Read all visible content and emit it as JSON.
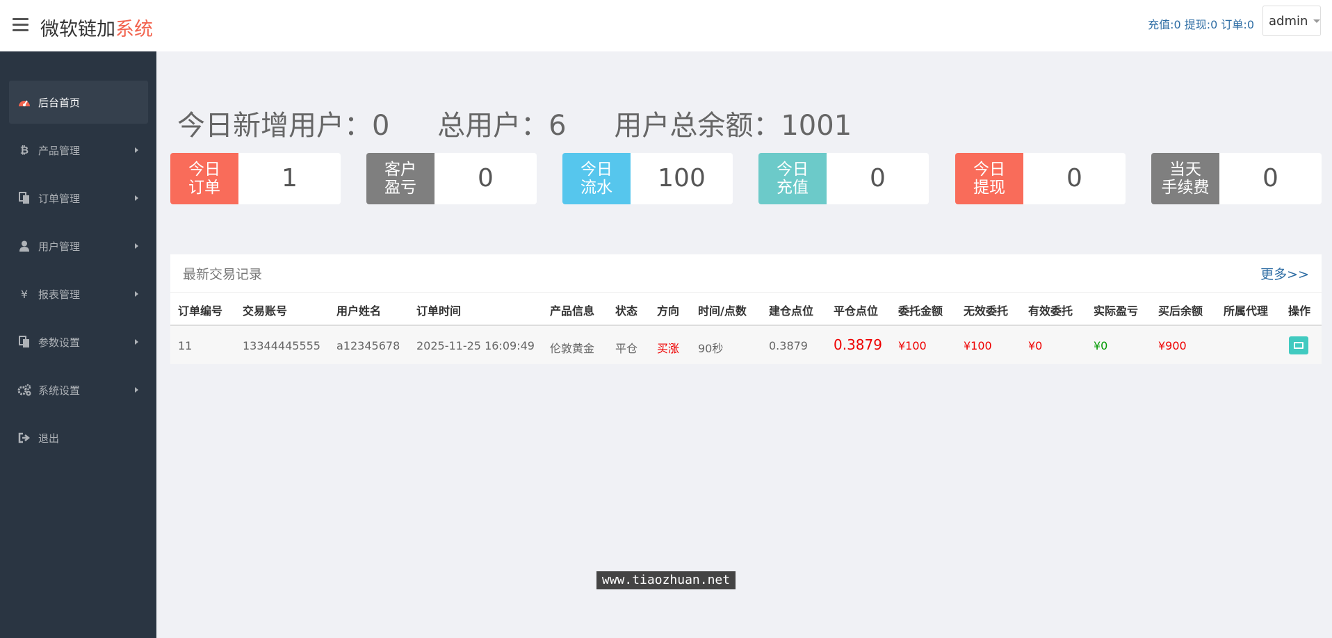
{
  "header": {
    "brand_main": "微软链加",
    "brand_accent": "系统",
    "counters": "充值:0 提现:0 订单:0",
    "user": "admin"
  },
  "sidebar": {
    "items": [
      {
        "label": "后台首页",
        "icon": "dashboard-icon"
      },
      {
        "label": "产品管理",
        "icon": "bitcoin-icon"
      },
      {
        "label": "订单管理",
        "icon": "copy-icon"
      },
      {
        "label": "用户管理",
        "icon": "user-icon"
      },
      {
        "label": "报表管理",
        "icon": "yen-icon"
      },
      {
        "label": "参数设置",
        "icon": "copy-icon"
      },
      {
        "label": "系统设置",
        "icon": "gears-icon"
      },
      {
        "label": "退出",
        "icon": "sign-out-icon"
      }
    ]
  },
  "summary": {
    "new_users": "今日新增用户：0",
    "total_users": "总用户：6",
    "total_balance": "用户总余额：1001"
  },
  "stats": [
    {
      "label_line1": "今日",
      "label_line2": "订单",
      "value": "1",
      "color": "#f96c5a"
    },
    {
      "label_line1": "客户",
      "label_line2": "盈亏",
      "value": "0",
      "color": "#7f7f7f"
    },
    {
      "label_line1": "今日",
      "label_line2": "流水",
      "value": "100",
      "color": "#56c6ed"
    },
    {
      "label_line1": "今日",
      "label_line2": "充值",
      "value": "0",
      "color": "#6ccac9"
    },
    {
      "label_line1": "今日",
      "label_line2": "提现",
      "value": "0",
      "color": "#f96c5a"
    },
    {
      "label_line1": "当天",
      "label_line2": "手续费",
      "value": "0",
      "color": "#7f7f7f"
    }
  ],
  "trades": {
    "title": "最新交易记录",
    "more": "更多>>",
    "columns": [
      "订单编号",
      "交易账号",
      "用户姓名",
      "订单时间",
      "产品信息",
      "状态",
      "方向",
      "时间/点数",
      "建仓点位",
      "平仓点位",
      "委托金额",
      "无效委托",
      "有效委托",
      "实际盈亏",
      "买后余额",
      "所属代理",
      "操作"
    ],
    "rows": [
      {
        "id": "11",
        "account": "13344445555",
        "name": "a12345678",
        "time": "2025-11-25 16:09:49",
        "product": "伦敦黄金",
        "status": "平仓",
        "direction": "买涨",
        "duration": "90秒",
        "open_price": "0.3879",
        "close_price": "0.3879",
        "amount": "¥100",
        "invalid": "¥100",
        "valid": "¥0",
        "pnl": "¥0",
        "balance_after": "¥900",
        "agent": ""
      }
    ]
  },
  "watermark": "www.tiaozhuan.net"
}
